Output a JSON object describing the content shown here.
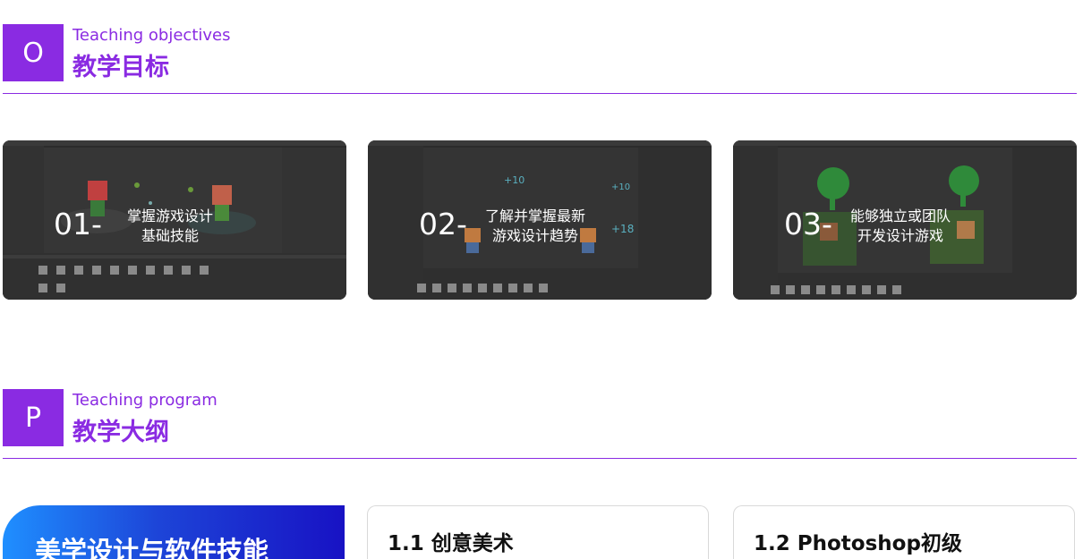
{
  "objectives": {
    "letter": "O",
    "title_en": "Teaching objectives",
    "title_zh": "教学目标",
    "cards": [
      {
        "num": "01-",
        "line1": "掌握游戏设计",
        "line2": "基础技能"
      },
      {
        "num": "02-",
        "line1": "了解并掌握最新",
        "line2": "游戏设计趋势"
      },
      {
        "num": "03-",
        "line1": "能够独立或团队",
        "line2": "开发设计游戏"
      }
    ]
  },
  "program": {
    "letter": "P",
    "title_en": "Teaching program",
    "title_zh": "教学大纲",
    "feature_title": "美学设计与软件技能",
    "items": [
      {
        "title": "1.1 创意美术"
      },
      {
        "title": "1.2 Photoshop初级"
      }
    ]
  },
  "colors": {
    "accent": "#8a2be2",
    "card_bg": "#2e2e2e",
    "gradient_start": "#1f8fff",
    "gradient_end": "#1812c4"
  }
}
